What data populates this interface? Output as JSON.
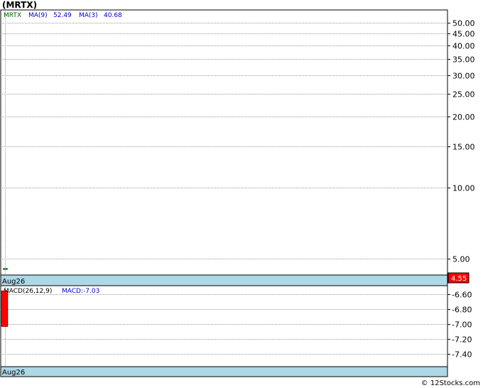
{
  "header": {
    "title": "(MRTX)"
  },
  "price_panel": {
    "legend": {
      "symbol": "MRTX",
      "ma9_label": "MA(9)",
      "ma9_value": "52.49",
      "ma3_label": "MA(3)",
      "ma3_value": "40.68"
    },
    "last_price_tag": "4.55",
    "date_band_label": "Aug26"
  },
  "macd_panel": {
    "legend": {
      "label": "MACD(26,12,9)",
      "value_text": "MACD:-7.03"
    },
    "date_band_label": "Aug26"
  },
  "footer": {
    "watermark": "© 12Stocks.com"
  },
  "colors": {
    "price_green": "#006400",
    "macd_red": "#ff0000",
    "legend_blue": "#0000cc",
    "band": "#add8e6",
    "tag_red": "#ff0000"
  },
  "chart_data": [
    {
      "type": "bar",
      "name": "price",
      "scale": "log",
      "ylim": [
        4.3,
        55
      ],
      "yticks": [
        50.0,
        45.0,
        40.0,
        35.0,
        30.0,
        25.0,
        20.0,
        15.0,
        10.0,
        5.0
      ],
      "ytick_labels": [
        "50.00",
        "45.00",
        "40.00",
        "35.00",
        "30.00",
        "25.00",
        "20.00",
        "15.00",
        "10.00",
        "5.00"
      ],
      "x": [
        "Aug26"
      ],
      "close": [
        4.55
      ]
    },
    {
      "type": "bar",
      "name": "macd",
      "ylim": [
        -7.55,
        -6.5
      ],
      "yticks": [
        -6.6,
        -6.8,
        -7.0,
        -7.2,
        -7.4
      ],
      "ytick_labels": [
        "-6.60",
        "-6.80",
        "-7.00",
        "-7.20",
        "-7.40"
      ],
      "x": [
        "Aug26"
      ],
      "bars": [
        {
          "from": -6.55,
          "to": -7.03
        }
      ]
    }
  ]
}
